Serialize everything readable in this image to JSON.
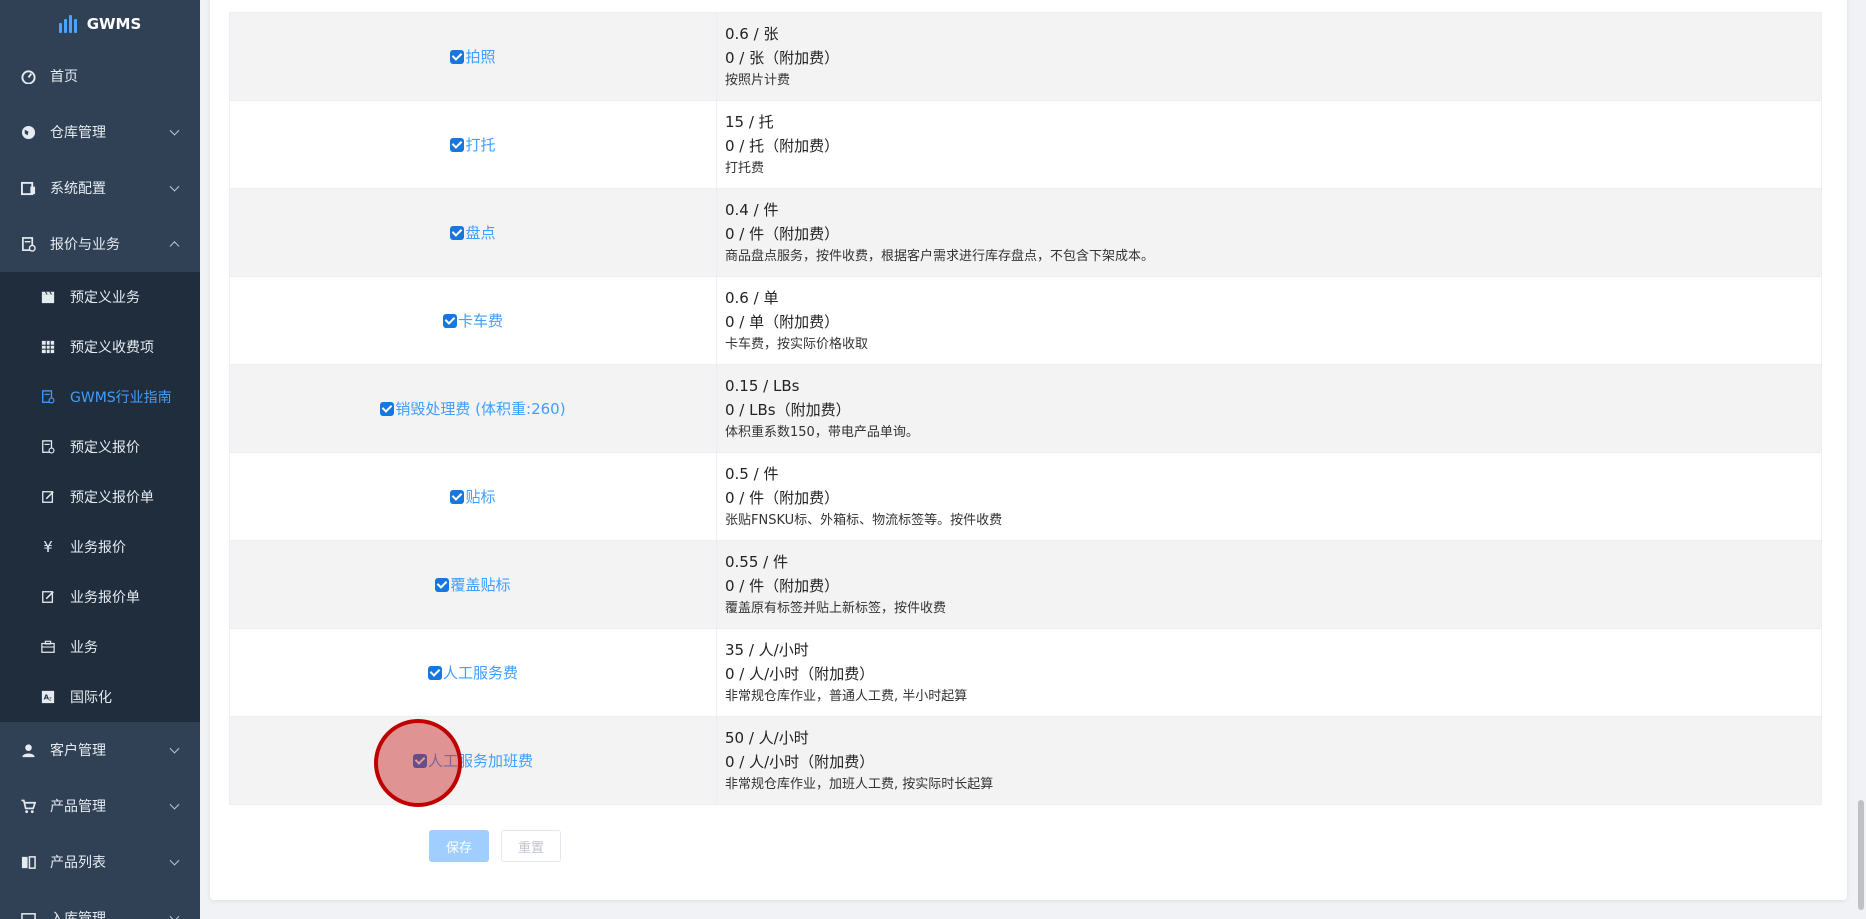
{
  "app": {
    "title": "GWMS"
  },
  "sidebar": {
    "items": [
      {
        "label": "首页",
        "icon": "dashboard-icon"
      },
      {
        "label": "仓库管理",
        "icon": "globe-icon"
      },
      {
        "label": "系统配置",
        "icon": "server-icon"
      },
      {
        "label": "报价与业务",
        "icon": "quote-icon",
        "expanded": true
      }
    ],
    "subitems": [
      {
        "label": "预定义业务",
        "icon": "clapperboard-icon"
      },
      {
        "label": "预定义收费项",
        "icon": "grid-icon"
      },
      {
        "label": "GWMS行业指南",
        "icon": "doc-icon",
        "active": true
      },
      {
        "label": "预定义报价",
        "icon": "doc-icon"
      },
      {
        "label": "预定义报价单",
        "icon": "edit-icon"
      },
      {
        "label": "业务报价",
        "icon": "yen-icon"
      },
      {
        "label": "业务报价单",
        "icon": "edit-icon"
      },
      {
        "label": "业务",
        "icon": "briefcase-icon"
      },
      {
        "label": "国际化",
        "icon": "translate-icon"
      }
    ],
    "bottom_items": [
      {
        "label": "客户管理",
        "icon": "user-icon"
      },
      {
        "label": "产品管理",
        "icon": "cart-icon"
      },
      {
        "label": "产品列表",
        "icon": "book-icon"
      },
      {
        "label": "入库管理",
        "icon": "inbox-icon"
      }
    ]
  },
  "services": [
    {
      "name": "拍照",
      "price": "0.6 / 张",
      "extra": "0 / 张（附加费）",
      "desc": "按照片计费"
    },
    {
      "name": "打托",
      "price": "15 / 托",
      "extra": "0 / 托（附加费）",
      "desc": "打托费"
    },
    {
      "name": "盘点",
      "price": "0.4 / 件",
      "extra": "0 / 件（附加费）",
      "desc": "商品盘点服务，按件收费，根据客户需求进行库存盘点，不包含下架成本。"
    },
    {
      "name": "卡车费",
      "price": "0.6 / 单",
      "extra": "0 / 单（附加费）",
      "desc": "卡车费，按实际价格收取"
    },
    {
      "name": "销毁处理费 (体积重:260)",
      "price": "0.15 / LBs",
      "extra": "0 / LBs（附加费）",
      "desc": "体积重系数150，带电产品单询。"
    },
    {
      "name": "贴标",
      "price": "0.5 / 件",
      "extra": "0 / 件（附加费）",
      "desc": "张贴FNSKU标、外箱标、物流标签等。按件收费"
    },
    {
      "name": "覆盖贴标",
      "price": "0.55 / 件",
      "extra": "0 / 件（附加费）",
      "desc": "覆盖原有标签并贴上新标签，按件收费"
    },
    {
      "name": "人工服务费",
      "price": "35 / 人/小时",
      "extra": "0 / 人/小时（附加费）",
      "desc": "非常规仓库作业，普通人工费, 半小时起算"
    },
    {
      "name": "人工服务加班费",
      "price": "50 / 人/小时",
      "extra": "0 / 人/小时（附加费）",
      "desc": "非常规仓库作业，加班人工费, 按实际时长起算"
    }
  ],
  "actions": {
    "save_label": "保存",
    "reset_label": "重置"
  },
  "colors": {
    "sidebar_bg": "#304156",
    "submenu_bg": "#1f2d3d",
    "accent": "#409eff",
    "checkbox": "#1677e0",
    "click_marker": "#c00000"
  }
}
